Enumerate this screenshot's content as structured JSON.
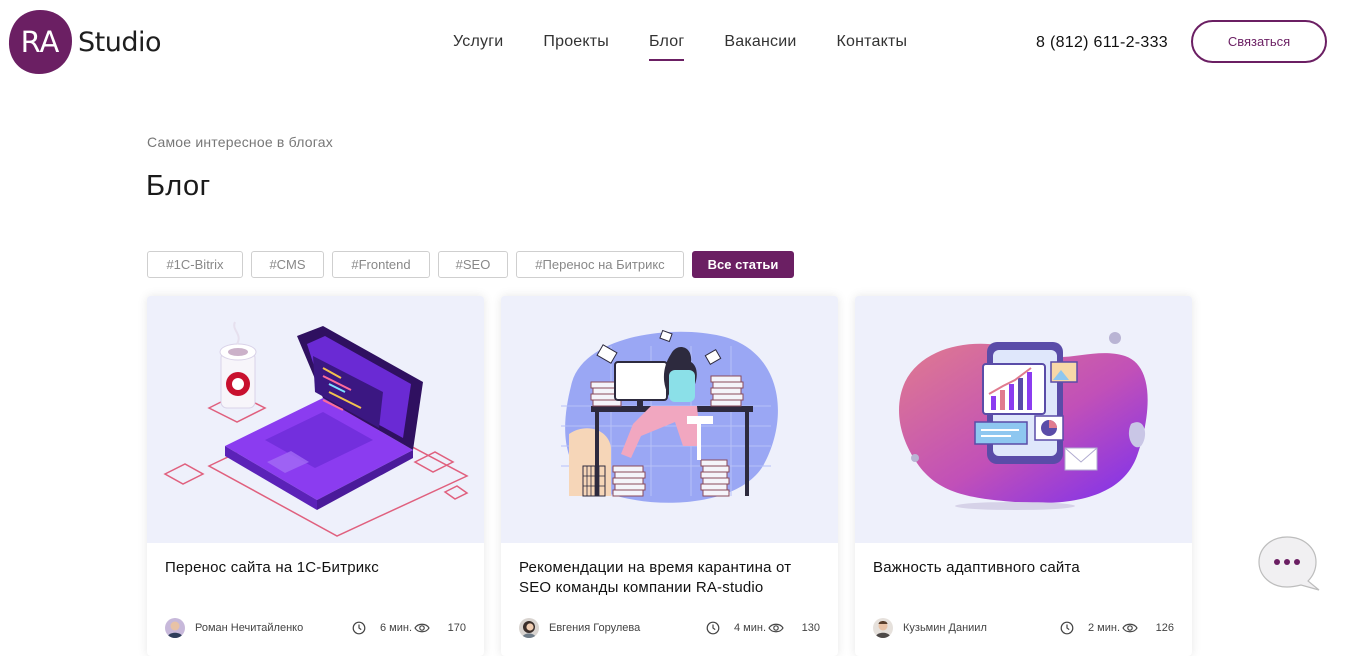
{
  "header": {
    "logo_mark": "RA",
    "logo_text": "Studio",
    "nav": [
      "Услуги",
      "Проекты",
      "Блог",
      "Вакансии",
      "Контакты"
    ],
    "active_nav": "Блог",
    "phone": "8 (812) 611-2-333",
    "cta": "Связаться"
  },
  "page": {
    "subtitle": "Самое интересное в блогах",
    "title": "Блог"
  },
  "tags": [
    "#1C-Bitrix",
    "#CMS",
    "#Frontend",
    "#SEO",
    "#Перенос на Битрикс",
    "Все статьи"
  ],
  "active_tag": "Все статьи",
  "cards": [
    {
      "title": "Перенос сайта на 1С-Битрикс",
      "author": "Роман Нечитайленко",
      "time": "6 мин.",
      "views": "170",
      "image": "laptop-illustration"
    },
    {
      "title": "Рекомендации на время карантина от SEO команды компании RA-studio",
      "author": "Евгения Горулева",
      "time": "4 мин.",
      "views": "130",
      "image": "desk-illustration"
    },
    {
      "title": "Важность адаптивного сайта",
      "author": "Кузьмин Даниил",
      "time": "2 мин.",
      "views": "126",
      "image": "phone-chart-illustration"
    }
  ],
  "colors": {
    "brand": "#6b1f63",
    "card_bg": "#eef0fb"
  },
  "icons": [
    "clock-icon",
    "eye-icon",
    "chat-icon"
  ]
}
